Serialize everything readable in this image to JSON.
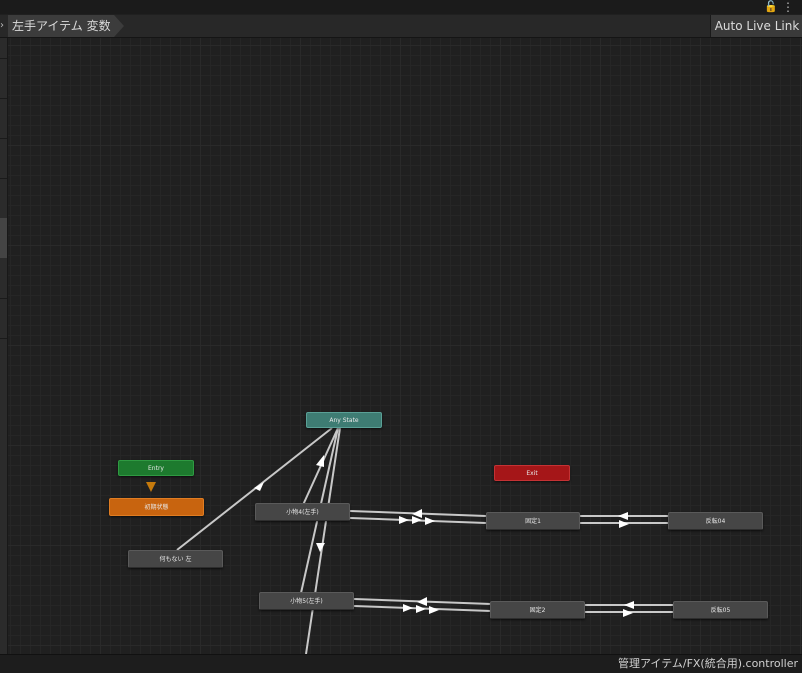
{
  "header": {
    "breadcrumb": "左手アイテム  変数",
    "live_link_button": "Auto Live Link"
  },
  "graph": {
    "states": {
      "any_state": "Any State",
      "entry": "Entry",
      "exit": "Exit",
      "default_state": "初期状態",
      "nothing_left": "何もない  左",
      "prop4": "小物4(左手)",
      "prop5": "小物5(左手)",
      "fixed1": "固定1",
      "fixed2": "固定2",
      "board04": "反転04",
      "board05": "反転05"
    },
    "colors": {
      "any_state": "#3e7c73",
      "entry": "#1d7a2e",
      "exit": "#a51618",
      "default_state": "#c8640f",
      "state": "#464646",
      "transition": "#c8c8c8"
    }
  },
  "status": {
    "controller_path": "管理アイテム/FX(統合用).controller"
  }
}
